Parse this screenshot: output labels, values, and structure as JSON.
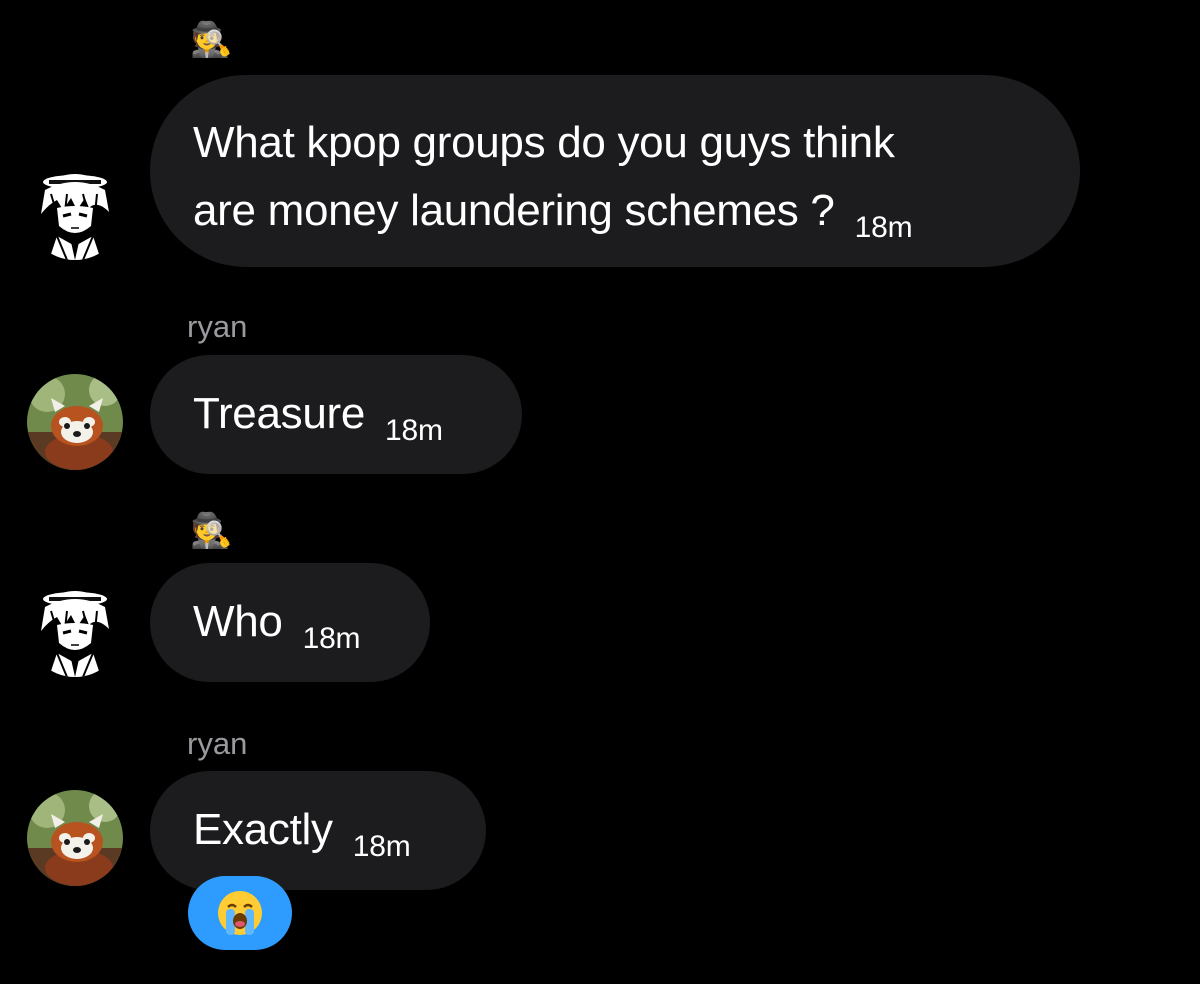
{
  "messages": [
    {
      "sender_emoji": "🕵️",
      "avatar": "anime-detective-avatar",
      "text": "What kpop groups do you guys think are money laundering schemes ?",
      "text_line1": "What kpop groups do you guys think",
      "text_line2": "are money laundering schemes ?",
      "time": "18m"
    },
    {
      "sender_name": "ryan",
      "avatar": "red-panda-avatar",
      "text": "Treasure",
      "time": "18m"
    },
    {
      "sender_emoji": "🕵️",
      "avatar": "anime-detective-avatar",
      "text": "Who",
      "time": "18m"
    },
    {
      "sender_name": "ryan",
      "avatar": "red-panda-avatar",
      "text": "Exactly",
      "time": "18m",
      "reaction": "😭"
    }
  ],
  "colors": {
    "background": "#000000",
    "bubble": "#1c1c1e",
    "sender_name": "#9a9a9e",
    "reaction_bg": "#2e9cff"
  }
}
